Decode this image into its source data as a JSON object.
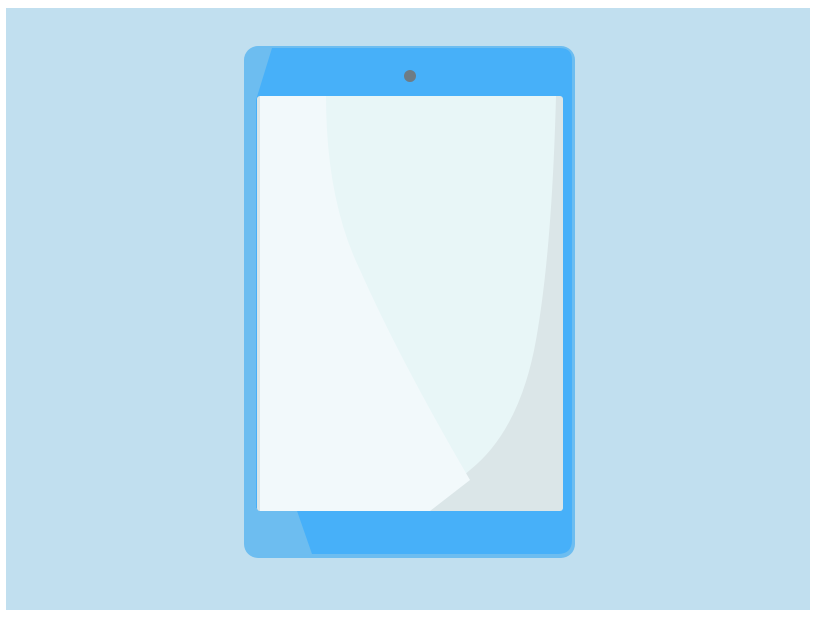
{
  "scene": {
    "subject": "tablet-illustration",
    "icons": [
      "tablet-icon",
      "front-camera-icon"
    ]
  },
  "colors": {
    "background_frame": "#ffffff",
    "background_panel": "#c1dfef",
    "tablet_body_light": "#6dbdf0",
    "tablet_body_main": "#47b0f9",
    "tablet_rim": "#74c0f0",
    "camera": "#6e7c85",
    "screen_base": "#dbe6e8",
    "screen_mid": "#e8f6f7",
    "screen_highlight": "#f2f9fb"
  }
}
